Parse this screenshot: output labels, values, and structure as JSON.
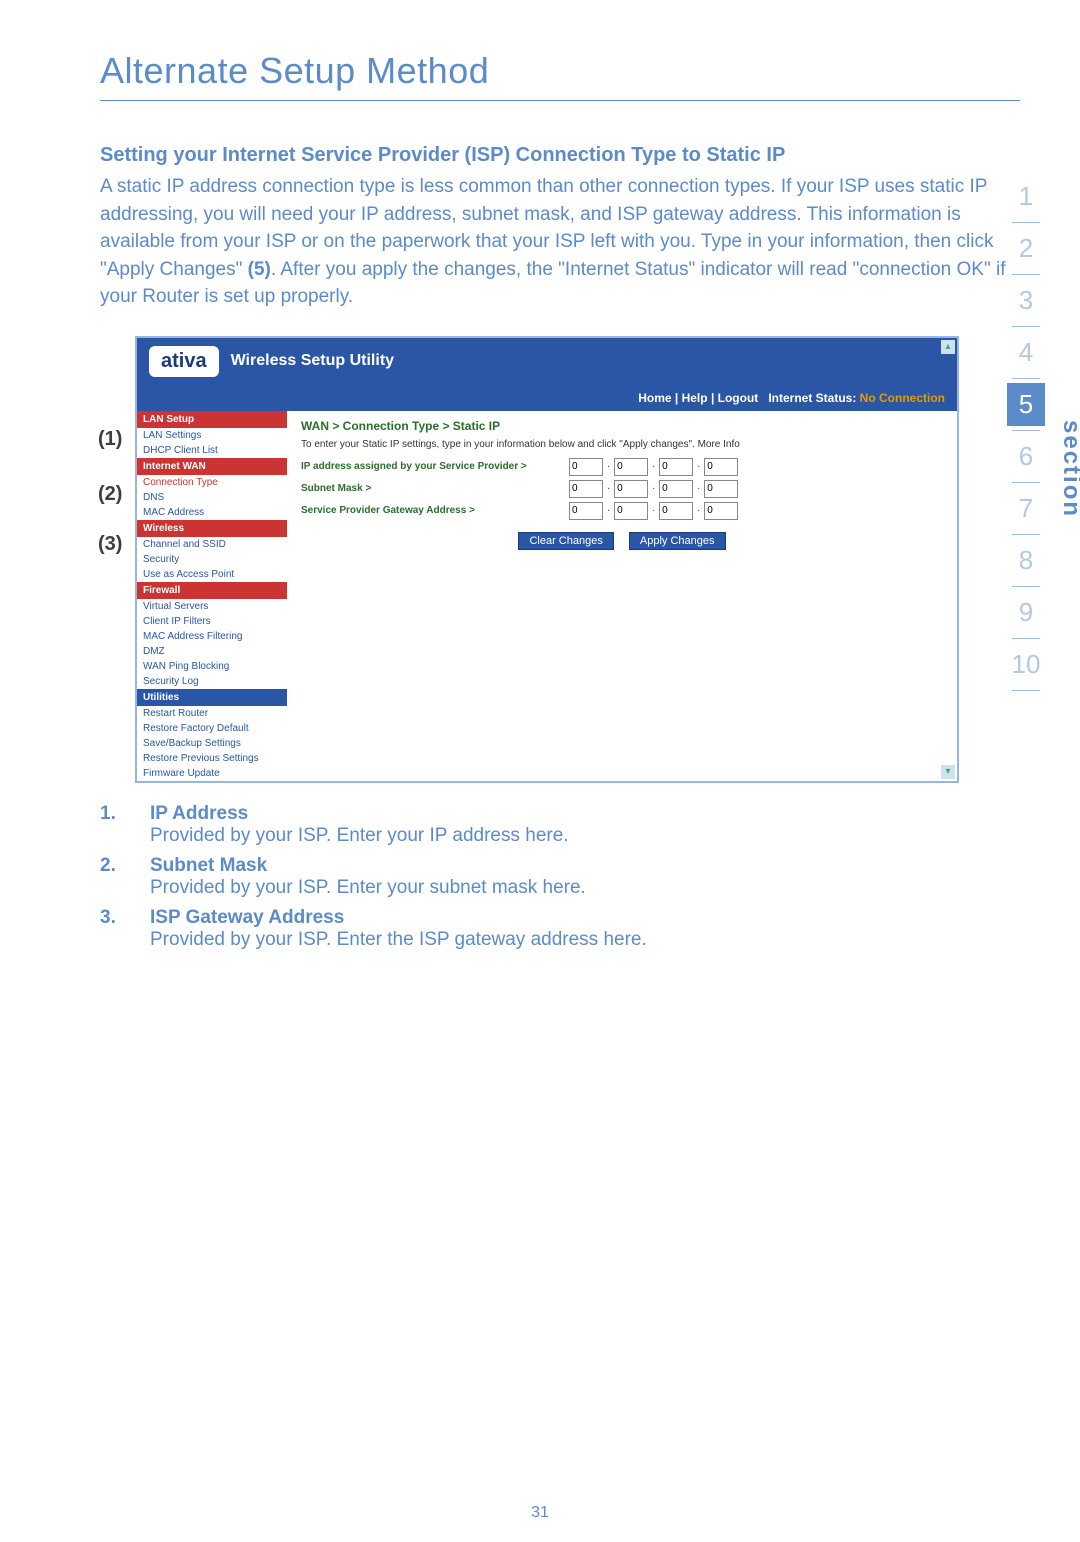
{
  "page_title": "Alternate Setup Method",
  "heading": "Setting your Internet Service Provider (ISP) Connection Type to Static IP",
  "body_text_1": "A static IP address connection type is less common than other connection types. If your ISP uses static IP addressing, you will need your IP address, subnet mask, and ISP gateway address. This information is available from your ISP or on the paperwork that your ISP left with you. Type in your information, then click \"Apply Changes\" ",
  "body_ref": "(5)",
  "body_text_2": ". After you apply the changes, the \"Internet Status\" indicator will read \"connection OK\" if your Router is set up properly.",
  "section_label": "section",
  "section_numbers": [
    "1",
    "2",
    "3",
    "4",
    "5",
    "6",
    "7",
    "8",
    "9",
    "10"
  ],
  "active_section": "5",
  "callouts": {
    "c1": "(1)",
    "c2": "(2)",
    "c3": "(3)"
  },
  "screenshot": {
    "logo": "ativa",
    "utility_title": "Wireless Setup Utility",
    "topbar": {
      "home": "Home",
      "help": "Help",
      "logout": "Logout",
      "status_label": "Internet Status:",
      "status_value": "No Connection"
    },
    "breadcrumb": "WAN > Connection Type > Static IP",
    "hint": "To enter your Static IP settings, type in your information below and click \"Apply changes\". More Info",
    "sidebar": {
      "lan_setup": "LAN Setup",
      "lan_settings": "LAN Settings",
      "dhcp": "DHCP Client List",
      "internet_wan": "Internet WAN",
      "connection_type": "Connection Type",
      "dns": "DNS",
      "mac": "MAC Address",
      "wireless": "Wireless",
      "channel": "Channel and SSID",
      "security": "Security",
      "use_ap": "Use as Access Point",
      "firewall": "Firewall",
      "virtual": "Virtual Servers",
      "client_ip": "Client IP Filters",
      "mac_filter": "MAC Address Filtering",
      "dmz": "DMZ",
      "wan_ping": "WAN Ping Blocking",
      "sec_log": "Security Log",
      "utilities": "Utilities",
      "restart": "Restart Router",
      "restore_fac": "Restore Factory Default",
      "save_backup": "Save/Backup Settings",
      "restore_prev": "Restore Previous Settings",
      "fw": "Firmware Update"
    },
    "form": {
      "ip_label": "IP address assigned by your Service Provider >",
      "subnet_label": "Subnet Mask >",
      "gw_label": "Service Provider Gateway Address >",
      "octet": "0",
      "clear_btn": "Clear Changes",
      "apply_btn": "Apply Changes"
    }
  },
  "defs": [
    {
      "num": "1.",
      "title": "IP Address",
      "desc": "Provided by your ISP. Enter your IP address here."
    },
    {
      "num": "2.",
      "title": "Subnet Mask",
      "desc": "Provided by your ISP. Enter your subnet mask here."
    },
    {
      "num": "3.",
      "title": "ISP Gateway Address",
      "desc": "Provided by your ISP. Enter the ISP gateway address here."
    }
  ],
  "page_number": "31"
}
